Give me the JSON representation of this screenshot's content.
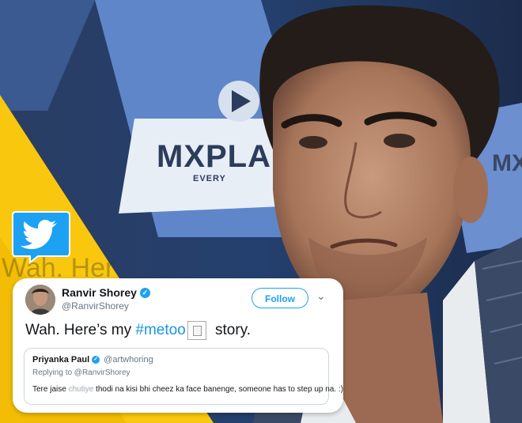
{
  "background": {
    "brand_text": "MXPLA",
    "brand_sub": "EVERY",
    "brand_text_right": "MX",
    "faded_text": "Wah. Her"
  },
  "twitter_badge": {
    "icon": "twitter-bird-icon",
    "color": "#1da1f2"
  },
  "tweet": {
    "name": "Ranvir Shorey",
    "handle": "@RanvirShorey",
    "follow_label": "Follow",
    "chevron": "⌄",
    "text_before": "Wah. Here’s my ",
    "hashtag": "#metoo",
    "text_after": " story.",
    "quote": {
      "name": "Priyanka Paul",
      "handle": "@artwhoring",
      "replying_to": "Replying to @RanvirShorey",
      "text_before": "Tere jaise ",
      "text_blurred": "chutiye",
      "text_after": " thodi na kisi bhi cheez ka face banenge, someone has to step up na. :)"
    }
  },
  "colors": {
    "accent_yellow": "#f9c80e",
    "twitter_blue": "#1da1f2"
  }
}
